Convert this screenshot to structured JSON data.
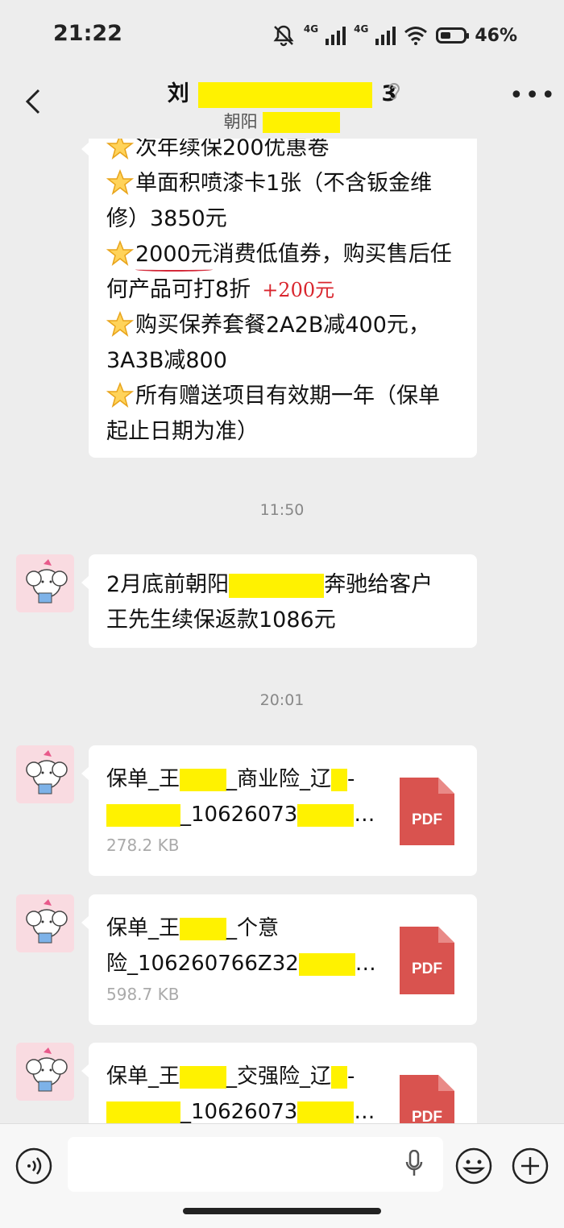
{
  "status_bar": {
    "time": "21:22",
    "network1": "4G",
    "network2": "4G",
    "battery_text": "46%",
    "battery_level": 0.46
  },
  "header": {
    "title_prefix": "刘",
    "title_suffix": "3",
    "subtitle_prefix": "朝阳"
  },
  "messages": {
    "promo_lines": [
      "次年续保200优惠卷",
      "单面积喷漆卡1张（不含钣金维修）3850元",
      "2000元",
      "消费低值券，购买售后任何产品可打8折",
      "+200元",
      "购买保养套餐2A2B减400元，3A3B减800",
      "所有赠送项目有效期一年（保单起止日期为准）"
    ],
    "ts1": "11:50",
    "refund_line1_a": "2月底前朝阳",
    "refund_line1_b": "奔驰给客户",
    "refund_line2": "王先生续保返款1086元",
    "ts2": "20:01",
    "files": [
      {
        "name_a": "保单_王",
        "name_b": "_商业险_辽",
        "name_c": "-",
        "name_d": "_10626073",
        "ellipsis": "…",
        "size": "278.2 KB",
        "icon": "PDF"
      },
      {
        "name_a": "保单_王",
        "name_b": "_个意",
        "name_c": "险_106260766Z32",
        "ellipsis": "…",
        "size": "598.7 KB",
        "icon": "PDF"
      },
      {
        "name_a": "保单_王",
        "name_b": "_交强险_辽",
        "name_c": "-",
        "name_d": "_10626073",
        "ellipsis": "…",
        "icon": "PDF"
      }
    ]
  },
  "colors": {
    "redaction": "#fff200",
    "pdf_red": "#d9534f",
    "background": "#ededed"
  }
}
